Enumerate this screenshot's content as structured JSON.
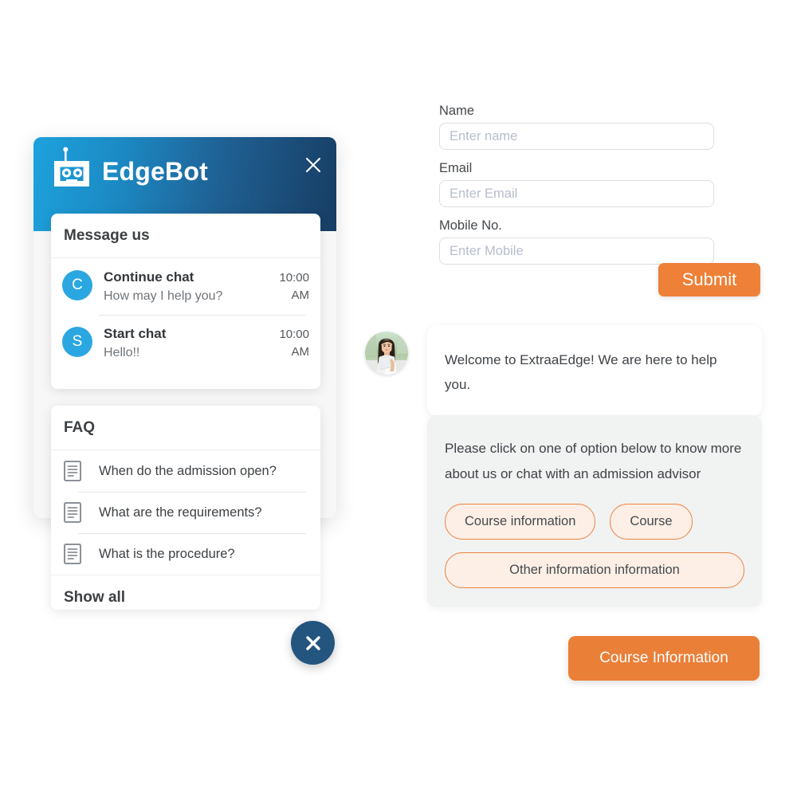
{
  "widget": {
    "header": {
      "title": "EdgeBot",
      "logo_icon": "robot-icon",
      "close_icon": "close-icon"
    },
    "message_card": {
      "title": "Message us",
      "items": [
        {
          "initial": "C",
          "title": "Continue chat",
          "subtitle": "How may I help you?",
          "time": "10:00",
          "meridiem": "AM"
        },
        {
          "initial": "S",
          "title": "Start chat",
          "subtitle": "Hello!!",
          "time": "10:00",
          "meridiem": "AM"
        }
      ]
    },
    "faq_card": {
      "title": "FAQ",
      "items": [
        {
          "text": "When do the admission open?",
          "icon": "document-icon"
        },
        {
          "text": "What are the requirements?",
          "icon": "document-icon"
        },
        {
          "text": "What is the procedure?",
          "icon": "document-icon"
        }
      ],
      "show_all_label": "Show all"
    },
    "fab_close_icon": "close-circle-icon"
  },
  "form": {
    "fields": [
      {
        "label": "Name",
        "placeholder": "Enter name",
        "value": ""
      },
      {
        "label": "Email",
        "placeholder": "Enter Email",
        "value": ""
      },
      {
        "label": "Mobile No.",
        "placeholder": "Enter Mobile",
        "value": ""
      }
    ],
    "submit_label": "Submit"
  },
  "chat": {
    "agent_avatar": "agent-photo",
    "welcome_message": "Welcome to ExtraaEdge! We are here to help you.",
    "options_prompt": "Please click on one of option below to know more about us or chat with an admission advisor",
    "options": [
      {
        "label": "Course information"
      },
      {
        "label": "Course"
      },
      {
        "label": "Other information information"
      }
    ],
    "user_reply": "Course Information"
  },
  "colors": {
    "header_gradient_start": "#1da2dd",
    "header_gradient_end": "#173d63",
    "accent_orange": "#ee8037",
    "chip_fill": "#fdefe6",
    "chip_border": "#ec8340",
    "avatar_blue": "#2aa7e0",
    "fab_blue": "#23557f",
    "bubble_gray": "#f1f2f2"
  }
}
